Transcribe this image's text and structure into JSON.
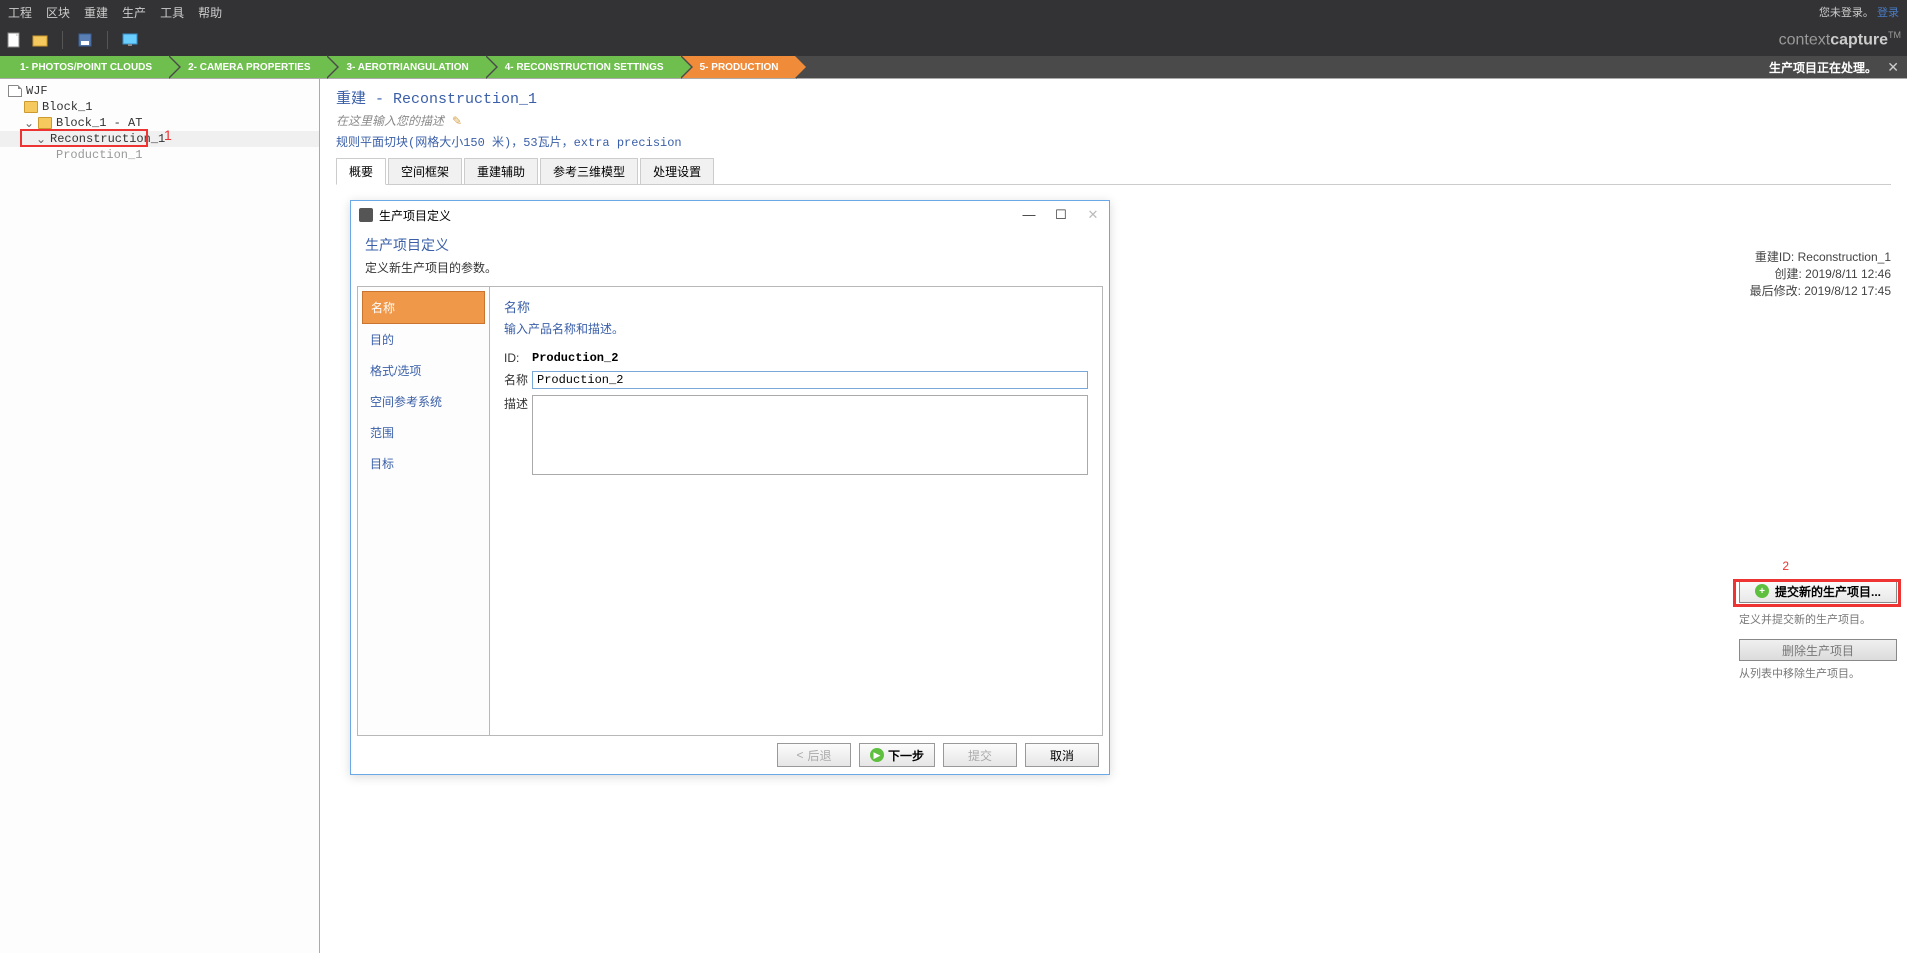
{
  "menu": {
    "items": [
      "工程",
      "区块",
      "重建",
      "生产",
      "工具",
      "帮助"
    ],
    "login_prefix": "您未登录。",
    "login_link": "登录"
  },
  "brand": {
    "prefix": "context",
    "bold": "capture",
    "tm": "TM"
  },
  "steps": {
    "items": [
      "1- PHOTOS/POINT CLOUDS",
      "2- CAMERA PROPERTIES",
      "3- AEROTRIANGULATION",
      "4- RECONSTRUCTION SETTINGS",
      "5- PRODUCTION"
    ],
    "status": "生产项目正在处理。"
  },
  "tree": {
    "root": "WJF",
    "block": "Block_1",
    "block_at": "Block_1 - AT",
    "reconstruction": "Reconstruction_1",
    "production": "Production_1"
  },
  "annotations": {
    "label1": "1",
    "label2": "2"
  },
  "content": {
    "title": "重建 - Reconstruction_1",
    "desc_placeholder": "在这里输入您的描述",
    "subtitle": "规则平面切块(网格大小150 米)，53瓦片，extra precision",
    "tabs": [
      "概要",
      "空间框架",
      "重建辅助",
      "参考三维模型",
      "处理设置"
    ]
  },
  "info": {
    "id_label": "重建ID:",
    "id_value": "Reconstruction_1",
    "created_label": "创建:",
    "created_value": "2019/8/11 12:46",
    "modified_label": "最后修改:",
    "modified_value": "2019/8/12 17:45"
  },
  "buttons": {
    "submit_new": "提交新的生产项目...",
    "submit_sub": "定义并提交新的生产项目。",
    "delete": "删除生产项目",
    "delete_sub": "从列表中移除生产项目。"
  },
  "dialog": {
    "window_title": "生产项目定义",
    "title": "生产项目定义",
    "subtitle": "定义新生产项目的参数。",
    "side_items": [
      "名称",
      "目的",
      "格式/选项",
      "空间参考系统",
      "范围",
      "目标"
    ],
    "main_title": "名称",
    "main_sub": "输入产品名称和描述。",
    "id_label": "ID:",
    "id_value": "Production_2",
    "name_label": "名称",
    "name_value": "Production_2",
    "desc_label": "描述",
    "btn_back": "后退",
    "btn_next": "下一步",
    "btn_submit": "提交",
    "btn_cancel": "取消"
  }
}
